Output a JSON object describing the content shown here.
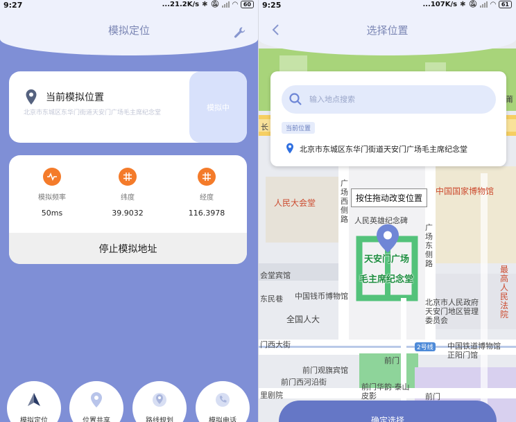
{
  "left": {
    "status": {
      "time": "9:27",
      "network": "...21.2K/s",
      "battery": "60"
    },
    "title": "模拟定位",
    "current": {
      "title": "当前模拟位置",
      "address": "北京市东城区东华门街道天安门广场毛主席纪念堂",
      "sim_button": "模拟中"
    },
    "stats": [
      {
        "label": "模拟频率",
        "value": "50ms",
        "icon": "pulse-icon"
      },
      {
        "label": "纬度",
        "value": "39.9032",
        "icon": "latitude-icon"
      },
      {
        "label": "经度",
        "value": "116.3978",
        "icon": "longitude-icon"
      }
    ],
    "stop_button": "停止模拟地址",
    "nav": [
      {
        "label": "模拟定位",
        "icon": "navigate-icon"
      },
      {
        "label": "位置共享",
        "icon": "location-share-icon"
      },
      {
        "label": "路线规划",
        "icon": "route-icon"
      },
      {
        "label": "模拟电话",
        "icon": "phone-icon"
      }
    ]
  },
  "right": {
    "status": {
      "time": "9:25",
      "network": "...107K/s",
      "battery": "61"
    },
    "title": "选择位置",
    "search": {
      "placeholder": "输入地点搜索"
    },
    "current_tag": "当前位置",
    "result_address": "北京市东城区东华门街道天安门广场毛主席纪念堂",
    "tooltip": "按住拖动改变位置",
    "confirm_button": "确定选择",
    "map_labels": {
      "renmin": "人民大会堂",
      "guojia": "中国国家博物馆",
      "west_road": "广场西侧路",
      "east_road": "广场东侧路",
      "monument": "人民英雄纪念碑",
      "tiananmen": "天安门广场",
      "memorial": "毛主席纪念堂",
      "coin_museum": "中国钱币博物馆",
      "npc": "全国人大",
      "guest_hotel": "会堂宾馆",
      "min_lane": "东民巷",
      "gov": "北京市人民政府天安门地区管理委员会",
      "xidajie": "门西大街",
      "line2": "2号线",
      "qianmen": "前门",
      "railway": "中国铁道博物馆正阳门馆",
      "qianmen_hotel": "前门观旗宾馆",
      "qianmen_xiyan": "前门西河沿街",
      "qianmen_huayun": "前门华韵·泰山皮影",
      "qianmen2": "前门",
      "theater": "里剧院",
      "highest": "最高人民法院",
      "chang": "长",
      "pu": "莆"
    }
  }
}
